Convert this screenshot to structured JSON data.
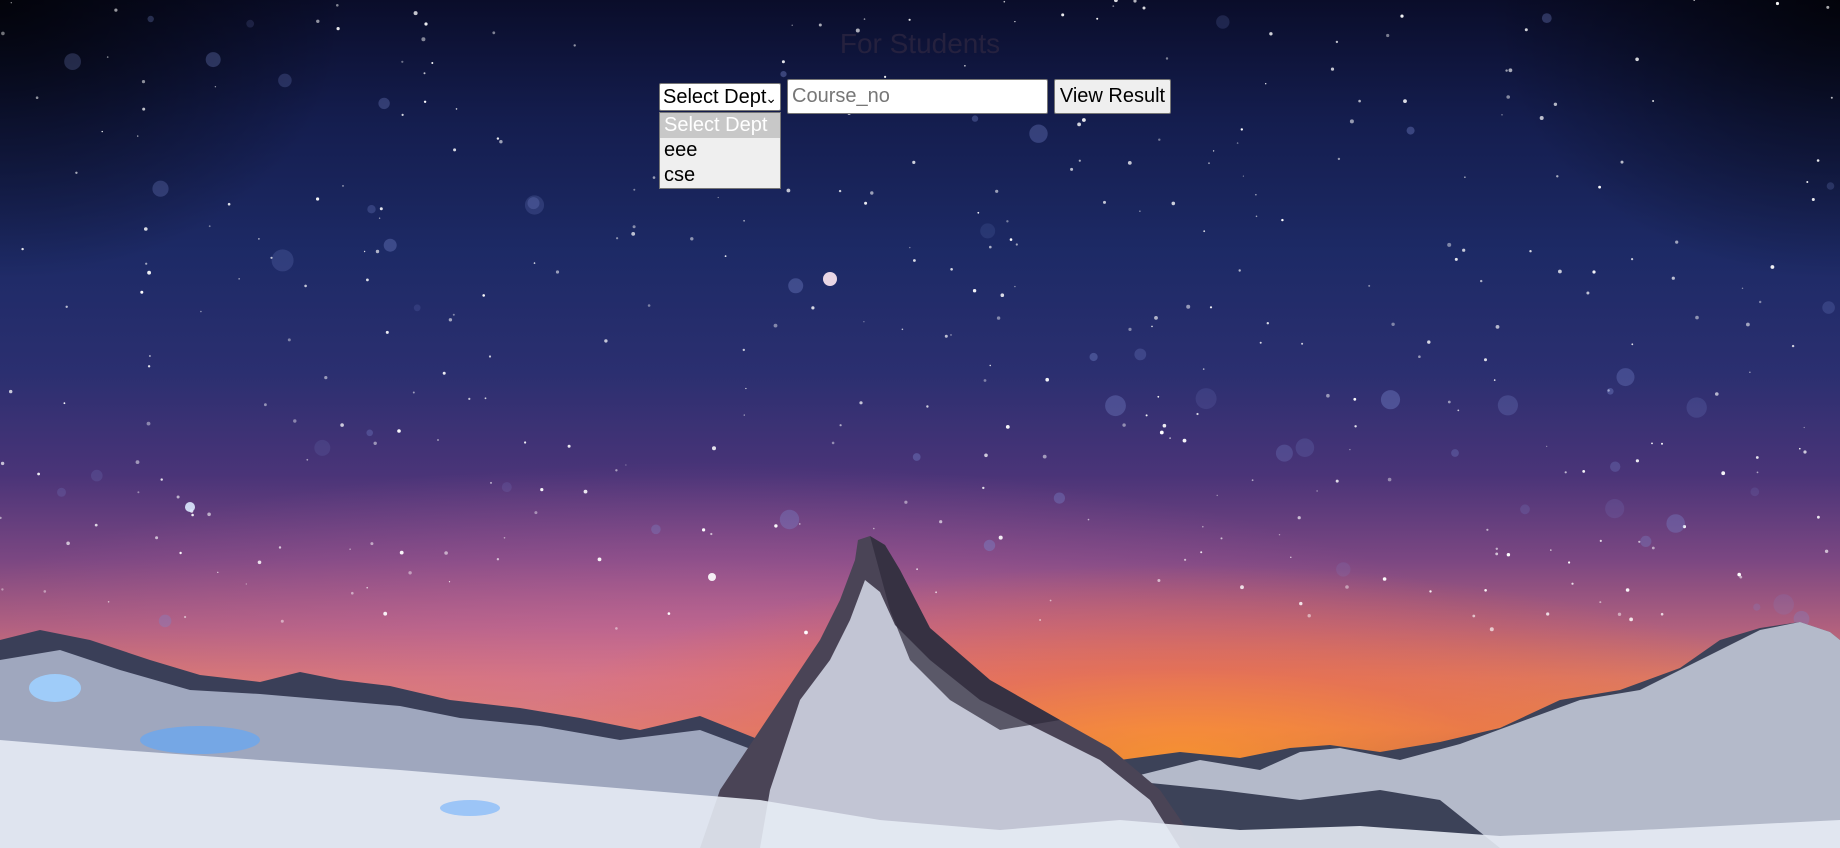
{
  "page": {
    "heading": "For Students"
  },
  "form": {
    "dept_select": {
      "selected": "Select Dept",
      "options": [
        "Select Dept",
        "eee",
        "cse"
      ]
    },
    "course_input": {
      "placeholder": "Course_no",
      "value": ""
    },
    "submit_label": "View Result"
  },
  "icons": {
    "select_chevron": "chevron-down-icon"
  },
  "colors": {
    "sky_top": "#0a0d2a",
    "horizon_glow": "#e38a55",
    "snow": "#dfe5f0"
  }
}
